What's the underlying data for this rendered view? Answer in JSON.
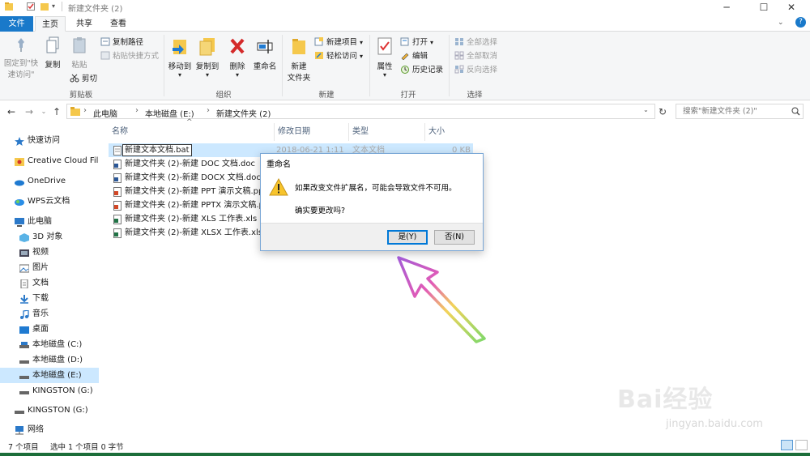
{
  "window": {
    "title": "新建文件夹 (2)"
  },
  "ribbon_tabs": [
    {
      "label": "文件"
    },
    {
      "label": "主页"
    },
    {
      "label": "共享"
    },
    {
      "label": "查看"
    }
  ],
  "ribbon": {
    "clipboard": {
      "pin_label_1": "固定到\"快",
      "pin_label_2": "速访问\"",
      "copy_label": "复制",
      "paste_label": "粘贴",
      "copy_path_label": "复制路径",
      "paste_shortcut_label": "粘贴快捷方式",
      "cut_label": "剪切",
      "group_label": "剪贴板"
    },
    "organize": {
      "move_to_label": "移动到",
      "copy_to_label": "复制到",
      "delete_label": "删除",
      "rename_label": "重命名",
      "group_label": "组织"
    },
    "new": {
      "new_folder_label_1": "新建",
      "new_folder_label_2": "文件夹",
      "new_item_label": "新建项目",
      "easy_access_label": "轻松访问",
      "group_label": "新建"
    },
    "open": {
      "properties_label": "属性",
      "open_label": "打开",
      "edit_label": "编辑",
      "history_label": "历史记录",
      "group_label": "打开"
    },
    "select": {
      "select_all_label": "全部选择",
      "select_none_label": "全部取消",
      "invert_label": "反向选择",
      "group_label": "选择"
    }
  },
  "address": {
    "crumbs": [
      "此电脑",
      "本地磁盘 (E:)",
      "新建文件夹 (2)"
    ],
    "search_placeholder": "搜索\"新建文件夹 (2)\""
  },
  "nav_pane": {
    "items": [
      {
        "label": "快速访问",
        "icon": "star-icon"
      },
      {
        "label": "Creative Cloud Files",
        "icon": "cloud-icon"
      },
      {
        "label": "OneDrive",
        "icon": "onedrive-icon"
      },
      {
        "label": "WPS云文档",
        "icon": "wps-cloud-icon"
      },
      {
        "label": "此电脑",
        "icon": "computer-icon"
      },
      {
        "label": "3D 对象",
        "icon": "3d-objects-icon"
      },
      {
        "label": "视频",
        "icon": "video-icon"
      },
      {
        "label": "图片",
        "icon": "pictures-icon"
      },
      {
        "label": "文档",
        "icon": "documents-icon"
      },
      {
        "label": "下载",
        "icon": "download-icon"
      },
      {
        "label": "音乐",
        "icon": "music-icon"
      },
      {
        "label": "桌面",
        "icon": "desktop-icon"
      },
      {
        "label": "本地磁盘 (C:)",
        "icon": "drive-icon"
      },
      {
        "label": "本地磁盘 (D:)",
        "icon": "drive-icon"
      },
      {
        "label": "本地磁盘 (E:)",
        "icon": "drive-icon"
      },
      {
        "label": "KINGSTON (G:)",
        "icon": "usb-drive-icon"
      },
      {
        "label": "KINGSTON (G:)",
        "icon": "usb-drive-icon"
      },
      {
        "label": "网络",
        "icon": "network-icon"
      }
    ]
  },
  "file_list": {
    "columns": [
      "名称",
      "修改日期",
      "类型",
      "大小"
    ],
    "sort_indicator": "^",
    "rows": [
      {
        "name": "新建文本文档.bat",
        "date": "2018-06-21 1:11",
        "type": "文本文档",
        "size": "0 KB",
        "renaming": true
      },
      {
        "name": "新建文件夹 (2)-新建 DOC 文档.doc"
      },
      {
        "name": "新建文件夹 (2)-新建 DOCX 文档.docx"
      },
      {
        "name": "新建文件夹 (2)-新建 PPT 演示文稿.ppt"
      },
      {
        "name": "新建文件夹 (2)-新建 PPTX 演示文稿.pptx"
      },
      {
        "name": "新建文件夹 (2)-新建 XLS 工作表.xls"
      },
      {
        "name": "新建文件夹 (2)-新建 XLSX 工作表.xlsx"
      }
    ]
  },
  "status": {
    "item_count": "7 个项目",
    "selection": "选中 1 个项目  0 字节"
  },
  "dialog": {
    "title": "重命名",
    "message_1": "如果改变文件扩展名，可能会导致文件不可用。",
    "message_2": "确实要更改吗?",
    "yes_label": "是(Y)",
    "no_label": "否(N)"
  },
  "watermark": {
    "brand": "Bai经验",
    "url": "jingyan.baidu.com"
  },
  "colors": {
    "accent": "#1979ca",
    "selection": "#cce8ff",
    "dialog_border": "#7aa7d6",
    "folder": "#f5c84c"
  }
}
